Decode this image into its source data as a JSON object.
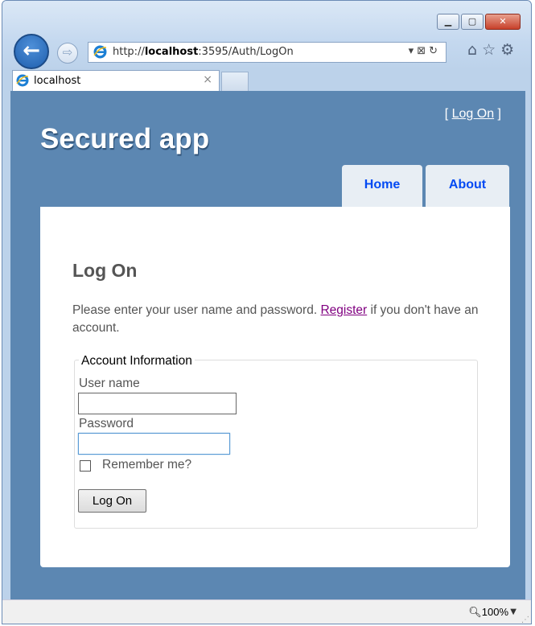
{
  "browser": {
    "url_prefix": "http://",
    "url_host": "localhost",
    "url_rest": ":3595/Auth/LogOn",
    "tab_label": "localhost",
    "zoom_label": "100%"
  },
  "site": {
    "logon_link": "Log On",
    "title": "Secured app",
    "menu": [
      {
        "label": "Home"
      },
      {
        "label": "About"
      }
    ]
  },
  "page": {
    "title": "Log On",
    "intro_before": "Please enter your user name and password.",
    "register_link": "Register",
    "intro_after": "if you don't have an account.",
    "legend": "Account Information",
    "username_label": "User name",
    "username_value": "",
    "password_label": "Password",
    "password_value": "",
    "remember_label": "Remember me?",
    "submit_label": "Log On"
  },
  "colors": {
    "site_background": "#5c87b2",
    "menu_link": "#034af3",
    "visited_link": "#800080"
  }
}
